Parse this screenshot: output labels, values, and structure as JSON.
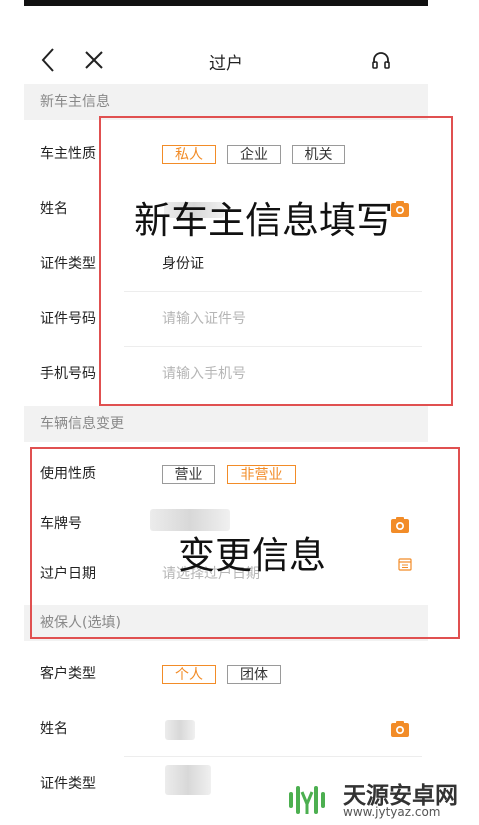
{
  "header": {
    "title": "过户"
  },
  "sections": {
    "new_owner": "新车主信息",
    "vehicle_change": "车辆信息变更",
    "insured": "被保人(选填)"
  },
  "new_owner": {
    "nature_label": "车主性质",
    "nature_options": [
      "私人",
      "企业",
      "机关"
    ],
    "name_label": "姓名",
    "id_type_label": "证件类型",
    "id_type_value": "身份证",
    "id_number_label": "证件号码",
    "id_number_placeholder": "请输入证件号",
    "phone_label": "手机号码",
    "phone_placeholder": "请输入手机号"
  },
  "vehicle": {
    "usage_label": "使用性质",
    "usage_options": [
      "营业",
      "非营业"
    ],
    "plate_label": "车牌号",
    "date_label": "过户日期",
    "date_placeholder": "请选择过户日期"
  },
  "insured": {
    "type_label": "客户类型",
    "type_options": [
      "个人",
      "团体"
    ],
    "name_label": "姓名",
    "id_type_label": "证件类型"
  },
  "annotations": {
    "box1": "新车主信息填写",
    "box2": "变更信息"
  },
  "watermark": {
    "name": "天源安卓网",
    "url": "www.jytyaz.com"
  },
  "colors": {
    "accent": "#f28c28",
    "annotation": "#e05050",
    "section_bg": "#f2f2f2"
  },
  "icons": [
    "back-icon",
    "close-icon",
    "headset-icon",
    "camera-icon",
    "calendar-icon"
  ]
}
